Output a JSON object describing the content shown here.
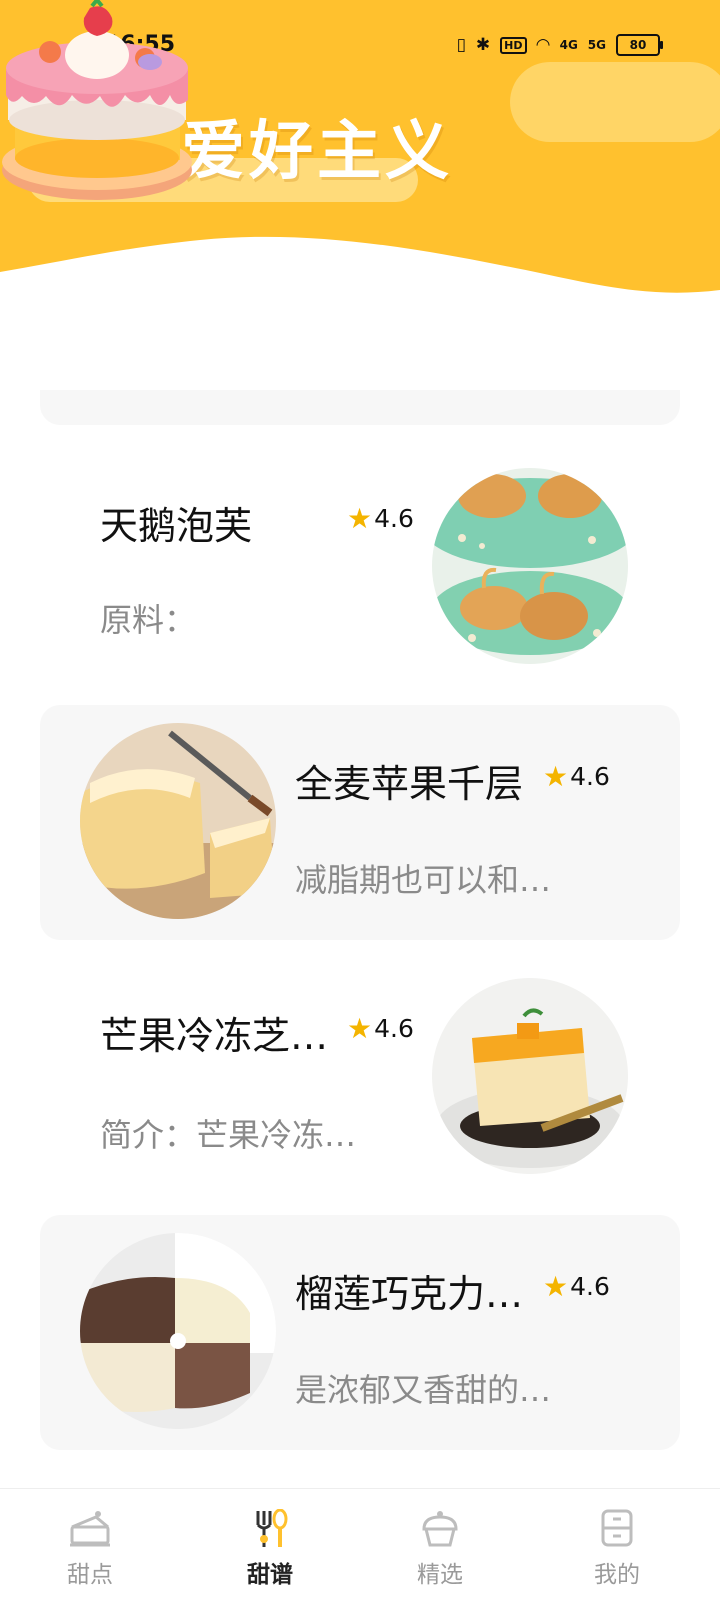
{
  "status_bar": {
    "time": "16:55",
    "hd_label": "HD",
    "signal_4g": "4G",
    "signal_5g": "5G",
    "battery": "80"
  },
  "banner": {
    "title": "甜品爱好主义",
    "accent_color": "#FFC12E"
  },
  "recipes": [
    {
      "name": "天鹅泡芙",
      "rating": "4.6",
      "desc": "原料："
    },
    {
      "name": "全麦苹果千层",
      "rating": "4.6",
      "desc": "减脂期也可以和…"
    },
    {
      "name": "芒果冷冻芝…",
      "rating": "4.6",
      "desc": "简介：芒果冷冻…"
    },
    {
      "name": "榴莲巧克力…",
      "rating": "4.6",
      "desc": "是浓郁又香甜的…"
    }
  ],
  "tabs": [
    {
      "label": "甜点",
      "icon": "cake-slice-icon",
      "active": false
    },
    {
      "label": "甜谱",
      "icon": "fork-spoon-icon",
      "active": true
    },
    {
      "label": "精选",
      "icon": "cupcake-icon",
      "active": false
    },
    {
      "label": "我的",
      "icon": "cabinet-icon",
      "active": false
    }
  ]
}
